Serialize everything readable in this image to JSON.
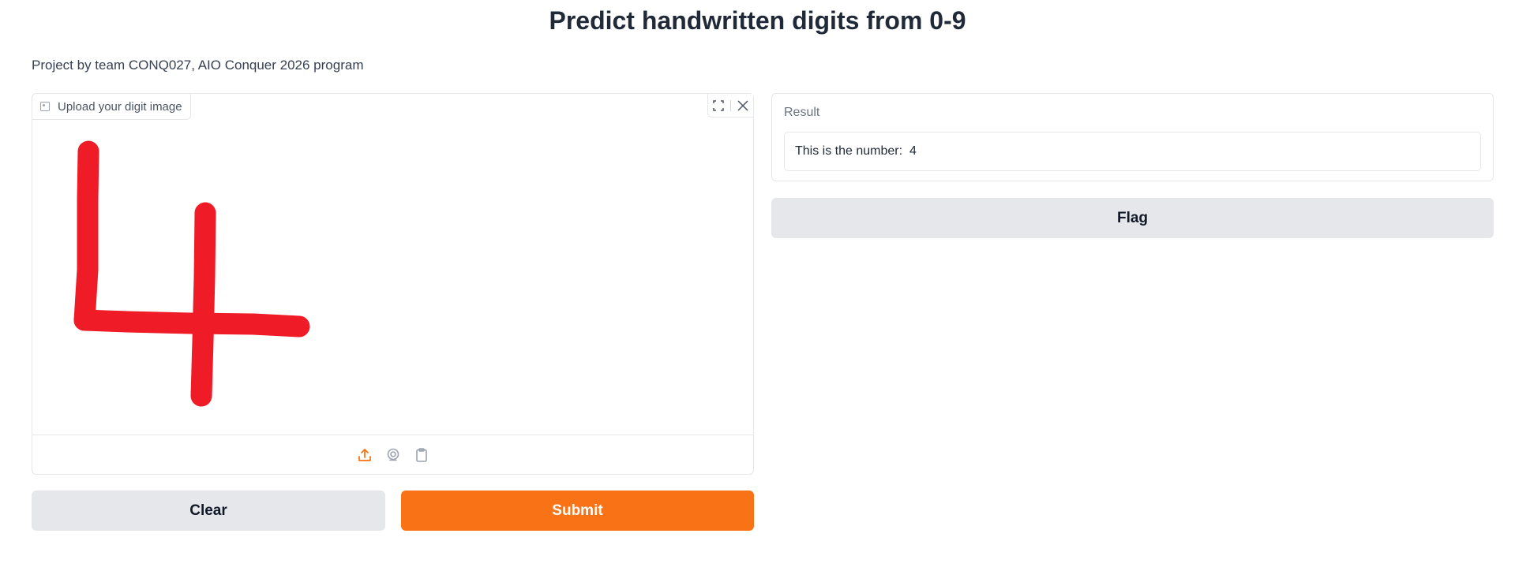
{
  "header": {
    "title": "Predict handwritten digits from 0-9",
    "description": "Project by team CONQ027, AIO Conquer 2026 program"
  },
  "image_input": {
    "label": "Upload your digit image",
    "stroke_color": "#ef1c27",
    "label_icon": "image-icon",
    "top_tools": [
      "fullscreen-icon",
      "close-icon"
    ],
    "sources": [
      "upload-icon",
      "webcam-icon",
      "clipboard-icon"
    ],
    "active_source_color": "#f97316"
  },
  "buttons": {
    "clear": "Clear",
    "submit": "Submit",
    "flag": "Flag"
  },
  "result": {
    "label": "Result",
    "value": "This is the number:  4"
  },
  "colors": {
    "accent": "#f97316",
    "secondary_button": "#e5e7eb",
    "border": "#e5e7eb"
  }
}
